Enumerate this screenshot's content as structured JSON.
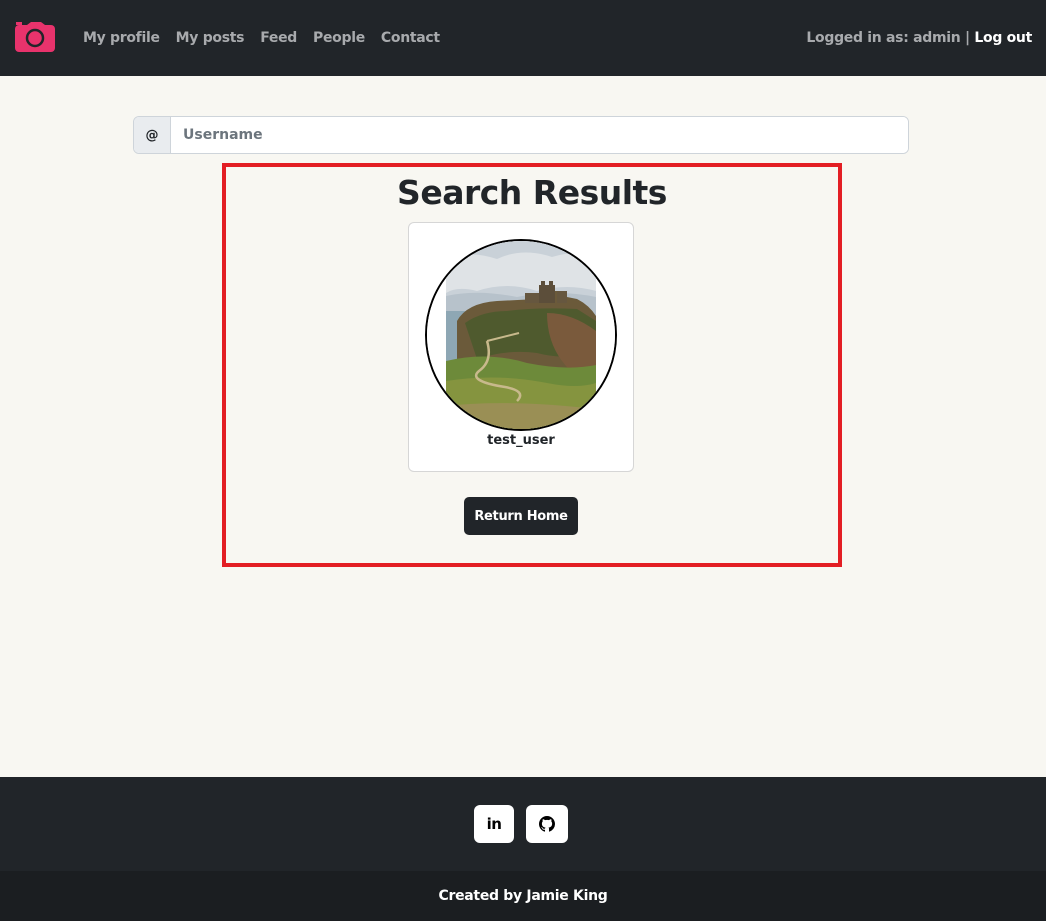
{
  "navbar": {
    "brand_icon": "camera-icon",
    "brand_color": "#e8336c",
    "links": [
      {
        "label": "My profile"
      },
      {
        "label": "My posts"
      },
      {
        "label": "Feed"
      },
      {
        "label": "People"
      },
      {
        "label": "Contact"
      }
    ],
    "logged_in_text": "Logged in as: admin |",
    "logout_label": "Log out"
  },
  "search": {
    "prefix": "@",
    "placeholder": "Username",
    "value": ""
  },
  "results": {
    "title": "Search Results",
    "highlight_color": "#e31e24",
    "users": [
      {
        "username": "test_user",
        "avatar": "castle-on-cliff-photo"
      }
    ],
    "return_label": "Return Home"
  },
  "footer": {
    "social": [
      {
        "icon": "linkedin-icon",
        "label": "in"
      },
      {
        "icon": "github-icon"
      }
    ],
    "credit": "Created by Jamie King"
  }
}
